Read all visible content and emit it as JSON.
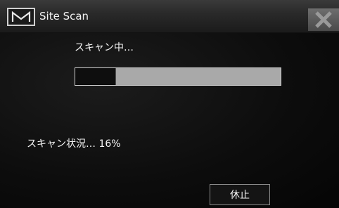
{
  "window": {
    "title": "Site Scan",
    "logo_icon": "m-logo-icon",
    "close_icon": "close-icon"
  },
  "scan": {
    "label": "スキャン中…",
    "status_text": "スキャン状況… 16%",
    "progress_percent": 16
  },
  "buttons": {
    "pause_label": "休止"
  },
  "colors": {
    "background": "#0d0d0d",
    "titlebar": "#2a2a2a",
    "progress_track": "#a9a9a9",
    "progress_fill": "#0e0e0e"
  }
}
